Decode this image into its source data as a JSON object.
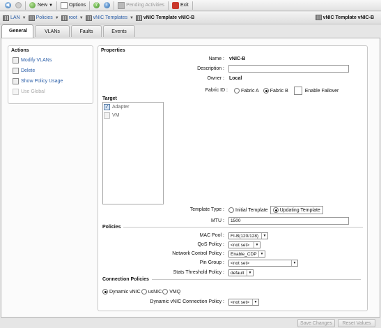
{
  "toolbar": {
    "new": "New",
    "options": "Options",
    "pending": "Pending Activities",
    "exit": "Exit"
  },
  "nav": {
    "lan": "LAN",
    "policies": "Policies",
    "root": "root",
    "vnic_templates": "vNIC Templates",
    "current": "vNIC Template vNIC-B",
    "right_title": "vNIC Template vNIC-B"
  },
  "tabs": [
    "General",
    "VLANs",
    "Faults",
    "Events"
  ],
  "actions": {
    "title": "Actions",
    "items": [
      "Modify VLANs",
      "Delete",
      "Show Policy Usage",
      "Use Global"
    ]
  },
  "properties": {
    "title": "Properties",
    "name_label": "Name :",
    "name_value": "vNIC-B",
    "description_label": "Description :",
    "description_value": "",
    "owner_label": "Owner :",
    "owner_value": "Local",
    "fabric_label": "Fabric ID :",
    "fabric_a": "Fabric A",
    "fabric_b": "Fabric B",
    "fabric_selected": "Fabric B",
    "enable_failover": "Enable Failover",
    "target_label": "Target",
    "targets": [
      {
        "label": "Adapter",
        "checked": true
      },
      {
        "label": "VM",
        "checked": false
      }
    ],
    "template_type_label": "Template Type :",
    "template_initial": "Initial Template",
    "template_updating": "Updating Template",
    "template_selected": "Updating Template",
    "mtu_label": "MTU :",
    "mtu_value": "1500"
  },
  "policies": {
    "title": "Policies",
    "mac_pool_label": "MAC Pool :",
    "mac_pool_value": "FI-B(120/128)",
    "qos_label": "QoS Policy :",
    "qos_value": "<not set>",
    "ncp_label": "Network Control Policy :",
    "ncp_value": "Enable_CDP",
    "pin_label": "Pin Group :",
    "pin_value": "<not set>",
    "stats_label": "Stats Threshold Policy :",
    "stats_value": "default"
  },
  "connection": {
    "title": "Connection Policies",
    "options": [
      "Dynamic vNIC",
      "usNIC",
      "VMQ"
    ],
    "selected": "Dynamic vNIC",
    "dcp_label": "Dynamic vNIC Connection Policy :",
    "dcp_value": "<not set>"
  },
  "footer": {
    "save": "Save Changes",
    "reset": "Reset Values"
  }
}
